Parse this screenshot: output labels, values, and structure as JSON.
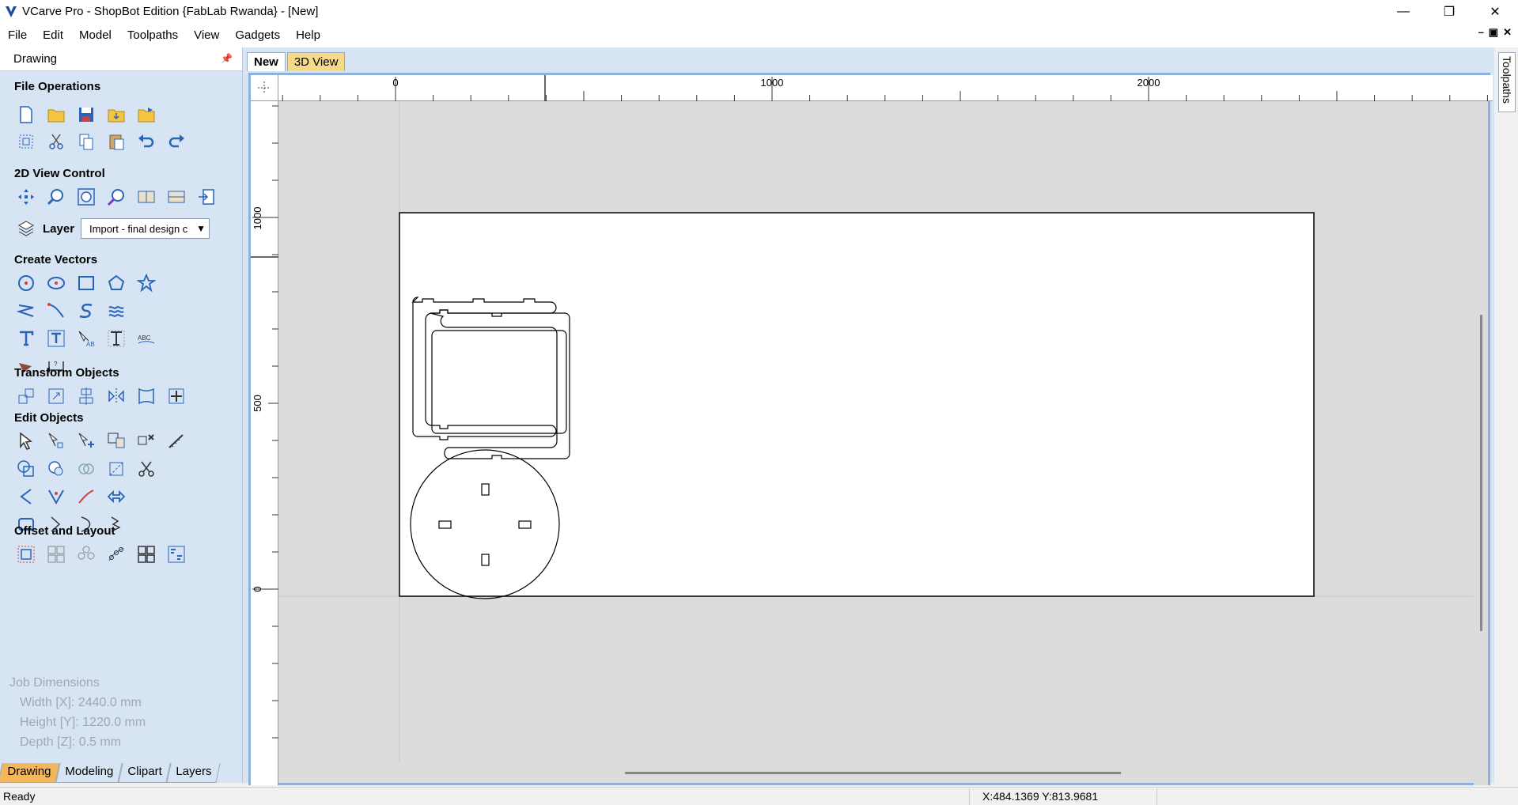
{
  "window": {
    "title": "VCarve Pro - ShopBot Edition {FabLab Rwanda} - [New]",
    "minimize": "—",
    "restore": "❐",
    "close": "✕"
  },
  "menu": {
    "items": [
      "File",
      "Edit",
      "Model",
      "Toolpaths",
      "View",
      "Gadgets",
      "Help"
    ],
    "mdi_min": "–",
    "mdi_restore": "▣",
    "mdi_close": "✕"
  },
  "left_panel": {
    "header": "Drawing",
    "sections": {
      "file_operations": "File Operations",
      "view_control": "2D View Control",
      "create_vectors": "Create Vectors",
      "transform_objects": "Transform Objects",
      "edit_objects": "Edit Objects",
      "offset_layout": "Offset and Layout"
    },
    "layer": {
      "label": "Layer",
      "value": "Import - final design c"
    },
    "job_dimensions": {
      "title": "Job Dimensions",
      "width": "Width  [X]: 2440.0 mm",
      "height": "Height [Y]: 1220.0 mm",
      "depth": "Depth  [Z]: 0.5 mm"
    },
    "bottom_tabs": [
      "Drawing",
      "Modeling",
      "Clipart",
      "Layers"
    ],
    "active_bottom_tab": "Drawing"
  },
  "doc_tabs": [
    "New",
    "3D View"
  ],
  "active_doc_tab": "New",
  "right_tab": "Toolpaths",
  "rulers": {
    "horizontal_labels": [
      "0",
      "1000",
      "2000"
    ],
    "vertical_labels": [
      "1000",
      "500",
      "0"
    ]
  },
  "status": {
    "text": "Ready",
    "coords": "X:484.1369 Y:813.9681"
  },
  "colors": {
    "panel_bg": "#d6e4f3",
    "active_tab": "#f4b65a",
    "icon_blue": "#2a64b8",
    "canvas_bg": "#dcdcdc"
  }
}
